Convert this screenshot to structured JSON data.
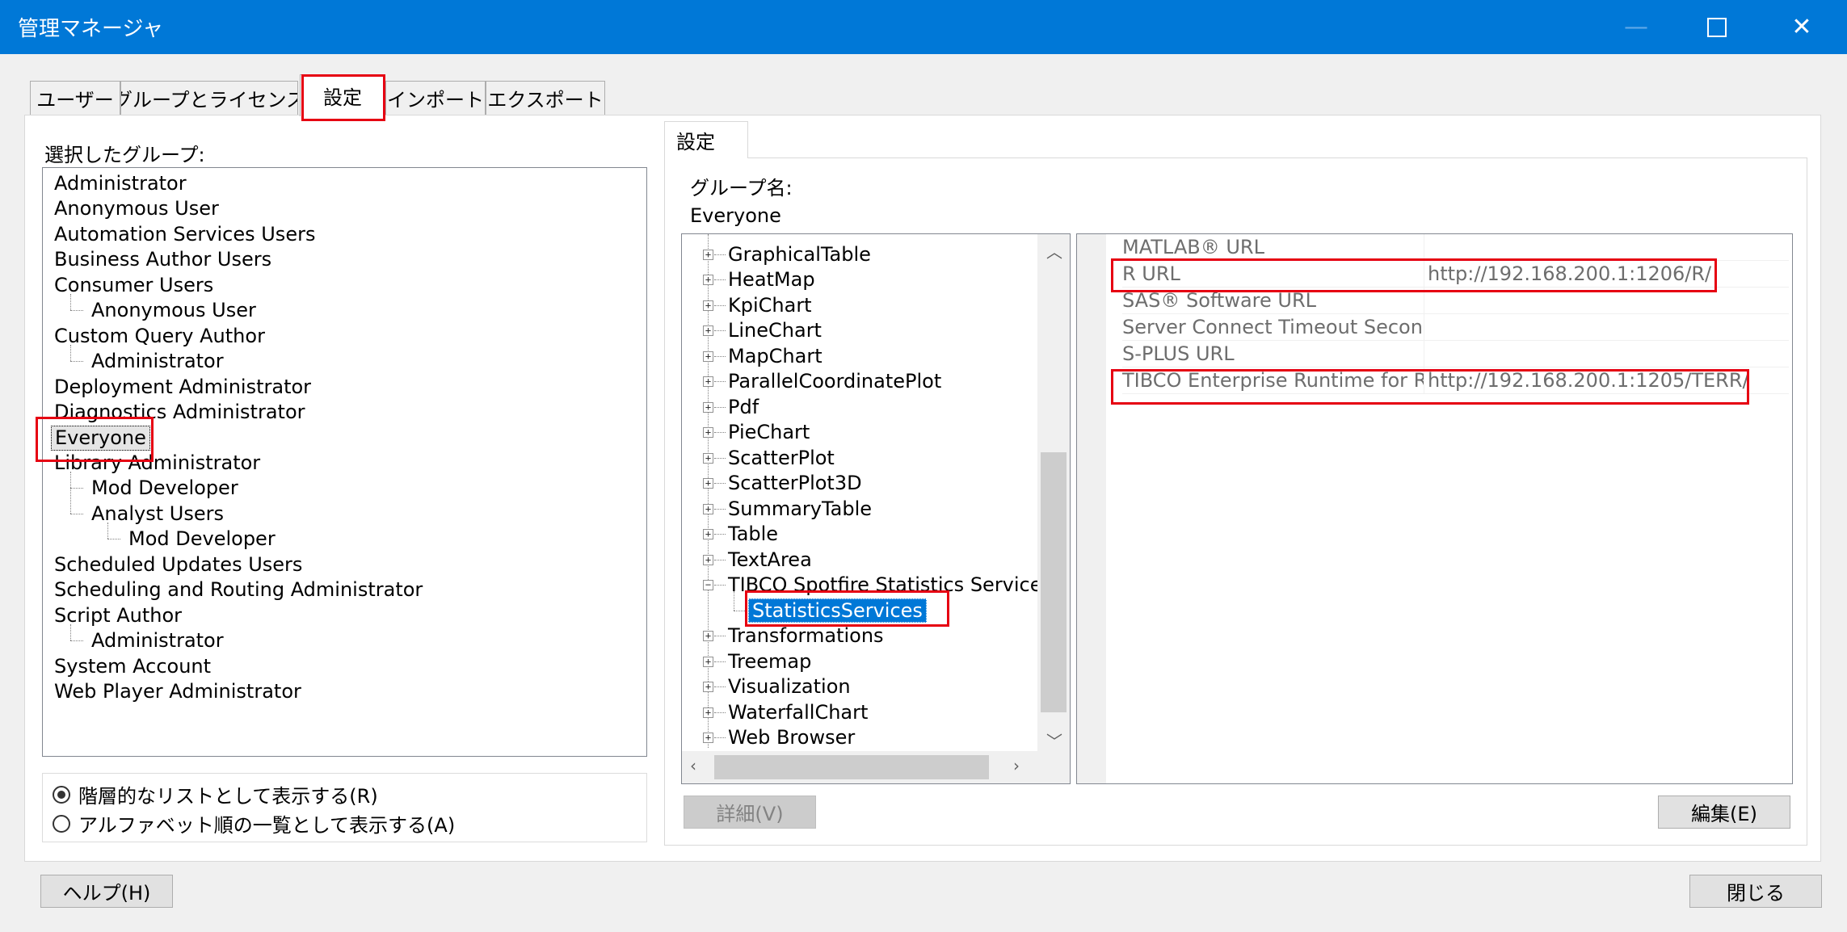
{
  "window": {
    "title": "管理マネージャ"
  },
  "tabs": [
    {
      "label": "ユーザー"
    },
    {
      "label": "グループとライセンス"
    },
    {
      "label": "設定"
    },
    {
      "label": "インポート"
    },
    {
      "label": "エクスポート"
    }
  ],
  "left": {
    "selected_group_label": "選択したグループ:",
    "groups": [
      {
        "label": "Administrator"
      },
      {
        "label": "Anonymous User"
      },
      {
        "label": "Automation Services Users"
      },
      {
        "label": "Business Author Users"
      },
      {
        "label": "Consumer Users"
      },
      {
        "label": "Anonymous User"
      },
      {
        "label": "Custom Query Author"
      },
      {
        "label": "Administrator"
      },
      {
        "label": "Deployment Administrator"
      },
      {
        "label": "Diagnostics Administrator"
      },
      {
        "label": "Everyone"
      },
      {
        "label": "Library Administrator"
      },
      {
        "label": "Mod Developer"
      },
      {
        "label": "Analyst Users"
      },
      {
        "label": "Mod Developer"
      },
      {
        "label": "Scheduled Updates Users"
      },
      {
        "label": "Scheduling and Routing Administrator"
      },
      {
        "label": "Script Author"
      },
      {
        "label": "Administrator"
      },
      {
        "label": "System Account"
      },
      {
        "label": "Web Player Administrator"
      }
    ],
    "selected_group": "Everyone",
    "view_options": [
      {
        "label": "階層的なリストとして表示する(R)",
        "selected": true
      },
      {
        "label": "アルファベット順の一覧として表示する(A)",
        "selected": false
      }
    ]
  },
  "right": {
    "tab_label": "設定",
    "group_name_label": "グループ名:",
    "group_name": "Everyone",
    "tree": [
      {
        "label": "GraphicalTable"
      },
      {
        "label": "HeatMap"
      },
      {
        "label": "KpiChart"
      },
      {
        "label": "LineChart"
      },
      {
        "label": "MapChart"
      },
      {
        "label": "ParallelCoordinatePlot"
      },
      {
        "label": "Pdf"
      },
      {
        "label": "PieChart"
      },
      {
        "label": "ScatterPlot"
      },
      {
        "label": "ScatterPlot3D"
      },
      {
        "label": "SummaryTable"
      },
      {
        "label": "Table"
      },
      {
        "label": "TextArea"
      },
      {
        "label": "TIBCO Spotfire Statistics Service"
      },
      {
        "label": "StatisticsServices"
      },
      {
        "label": "Transformations"
      },
      {
        "label": "Treemap"
      },
      {
        "label": "Visualization"
      },
      {
        "label": "WaterfallChart"
      },
      {
        "label": "Web Browser"
      }
    ],
    "properties": [
      {
        "name": "MATLAB® URL",
        "value": ""
      },
      {
        "name": "R URL",
        "value": "http://192.168.200.1:1206/R/"
      },
      {
        "name": "SAS® Software URL",
        "value": ""
      },
      {
        "name": "Server Connect Timeout Seconds",
        "value": ""
      },
      {
        "name": "S-PLUS URL",
        "value": ""
      },
      {
        "name": "TIBCO Enterprise Runtime for R",
        "value": "http://192.168.200.1:1205/TERR/"
      }
    ],
    "details_button": "詳細(V)",
    "edit_button": "編集(E)"
  },
  "footer": {
    "help_button": "ヘルプ(H)",
    "close_button": "閉じる"
  },
  "colors": {
    "titlebar": "#0078d7",
    "selection": "#0078d7",
    "highlight_box": "#e60012"
  }
}
